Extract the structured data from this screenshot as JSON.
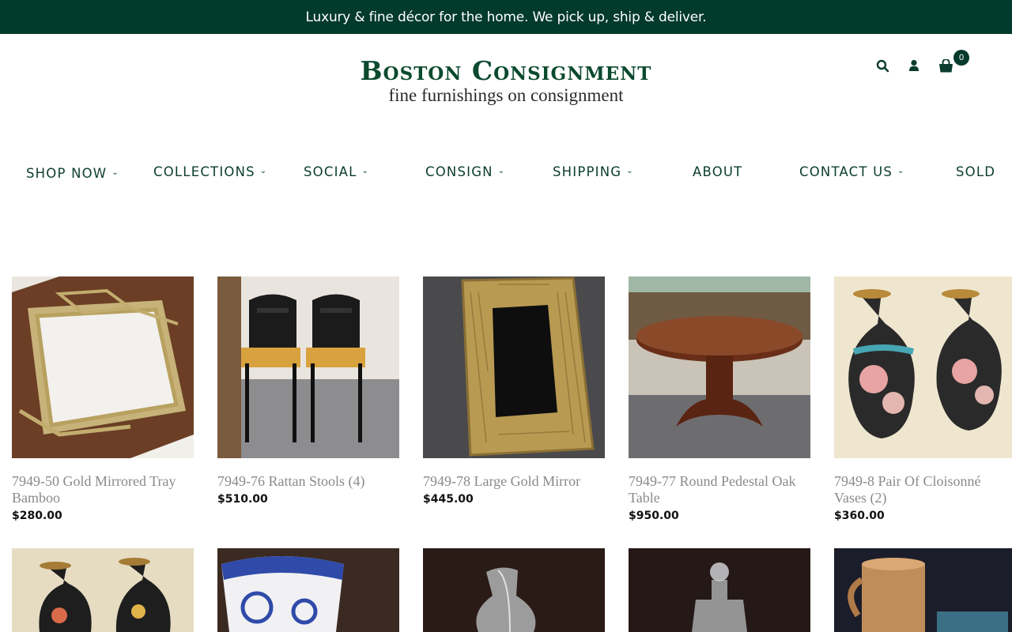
{
  "announcement": "Luxury & fine décor for the home. We pick up, ship & deliver.",
  "brand": {
    "title": "Boston Consignment",
    "subtitle": "fine furnishings on consignment"
  },
  "header_icons": {
    "search": "search-icon",
    "account": "user-icon",
    "cart": "shopping-bag-icon",
    "cart_count": "0"
  },
  "nav": [
    {
      "label": "SHOP NOW",
      "dropdown": true
    },
    {
      "label": "COLLECTIONS",
      "dropdown": true
    },
    {
      "label": "SOCIAL",
      "dropdown": true
    },
    {
      "label": "CONSIGN",
      "dropdown": true
    },
    {
      "label": "SHIPPING",
      "dropdown": true
    },
    {
      "label": "ABOUT",
      "dropdown": false
    },
    {
      "label": "CONTACT US",
      "dropdown": true
    },
    {
      "label": "SOLD",
      "dropdown": false
    }
  ],
  "products": [
    {
      "title": "7949-50 Gold Mirrored Tray Bamboo",
      "price": "$280.00"
    },
    {
      "title": "7949-76 Rattan Stools (4)",
      "price": "$510.00"
    },
    {
      "title": "7949-78 Large Gold Mirror",
      "price": "$445.00"
    },
    {
      "title": "7949-77 Round Pedestal Oak Table",
      "price": "$950.00"
    },
    {
      "title": "7949-8 Pair Of Cloisonné Vases (2)",
      "price": "$360.00"
    }
  ],
  "colors": {
    "brand_green": "#023a2b",
    "nav_text": "#0b3d2e",
    "product_title": "#8a8a8a",
    "price": "#111111"
  }
}
